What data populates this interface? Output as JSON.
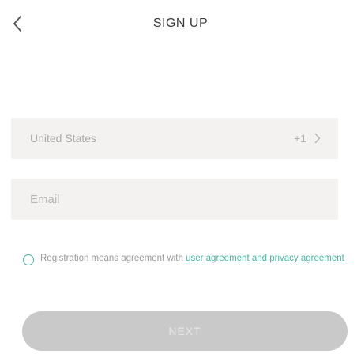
{
  "header": {
    "title": "SIGN UP",
    "back_icon": "chevron-left-icon"
  },
  "form": {
    "country": {
      "name": "United States",
      "code": "+1",
      "chevron_icon": "chevron-right-icon"
    },
    "email": {
      "value": "",
      "placeholder": "Email"
    },
    "agreement": {
      "checked": false,
      "text": "Registration means agreement with ",
      "link": "user agreement and privacy agreement"
    },
    "next_label": "NEXT"
  },
  "colors": {
    "accent": "#49b6a3",
    "field_bg": "#f3f2f1",
    "button_disabled": "#c9c9c9"
  }
}
